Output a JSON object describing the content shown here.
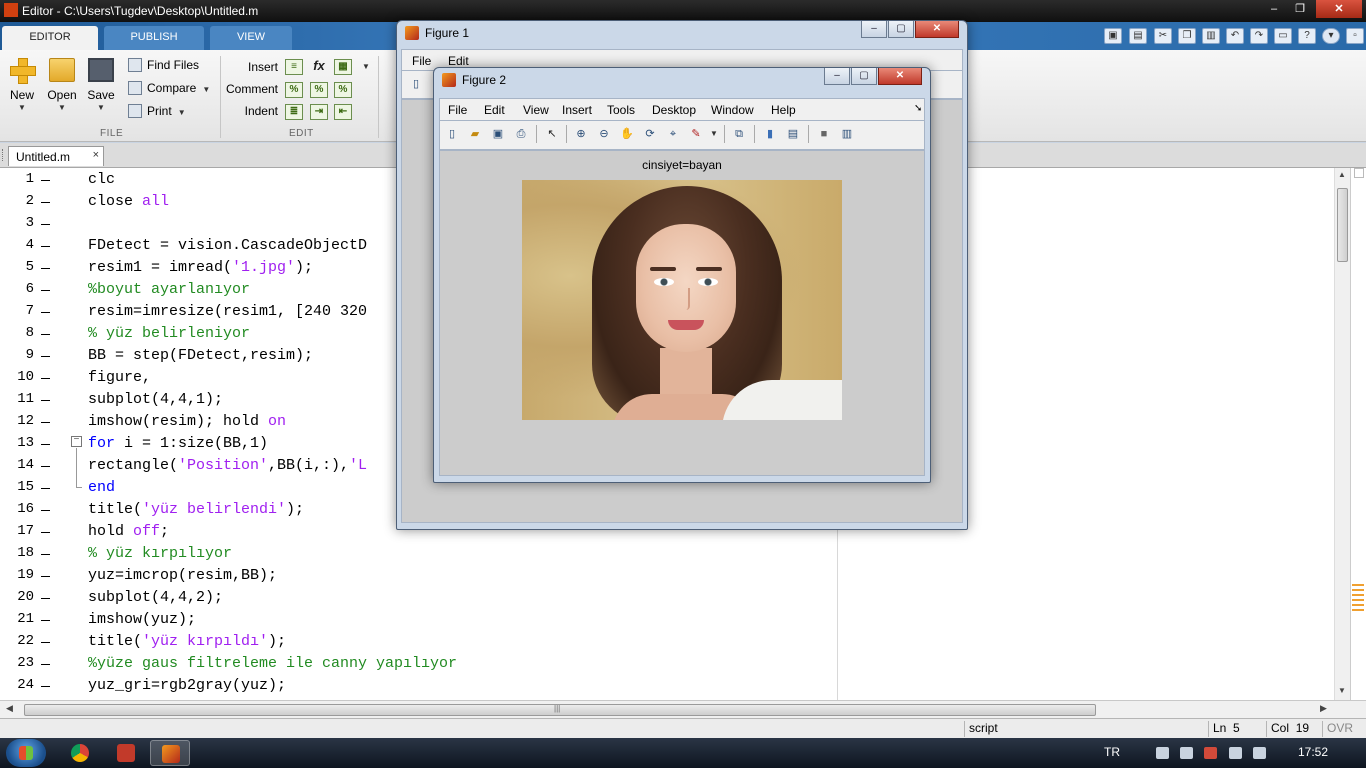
{
  "window": {
    "title": "Editor - C:\\Users\\Tugdev\\Desktop\\Untitled.m",
    "controls": {
      "minimize": "–",
      "maximize": "❐",
      "close": "✕"
    }
  },
  "ribbon": {
    "tabs": [
      "EDITOR",
      "PUBLISH",
      "VIEW"
    ],
    "file_group": {
      "label": "FILE",
      "new": "New",
      "open": "Open",
      "save": "Save",
      "find_files": "Find Files",
      "compare": "Compare",
      "print": "Print"
    },
    "edit_group": {
      "label": "EDIT",
      "insert": "Insert",
      "comment": "Comment",
      "indent": "Indent",
      "fx": "fx"
    }
  },
  "document_tabs": [
    {
      "name": "Untitled.m",
      "close": "×"
    }
  ],
  "editor": {
    "lines": [
      {
        "n": "1",
        "segs": [
          {
            "t": "clc",
            "c": "plain"
          }
        ]
      },
      {
        "n": "2",
        "segs": [
          {
            "t": "close ",
            "c": "plain"
          },
          {
            "t": "all",
            "c": "str"
          }
        ]
      },
      {
        "n": "3",
        "segs": []
      },
      {
        "n": "4",
        "segs": [
          {
            "t": "FDetect = vision.CascadeObjectD",
            "c": "plain"
          }
        ]
      },
      {
        "n": "5",
        "segs": [
          {
            "t": "resim1 = imread(",
            "c": "plain"
          },
          {
            "t": "'1.jpg'",
            "c": "str"
          },
          {
            "t": ");",
            "c": "plain"
          }
        ]
      },
      {
        "n": "6",
        "segs": [
          {
            "t": "%boyut ayarlanıyor",
            "c": "cmt"
          }
        ]
      },
      {
        "n": "7",
        "segs": [
          {
            "t": "resim=imresize(resim1, [240 320",
            "c": "plain"
          }
        ]
      },
      {
        "n": "8",
        "segs": [
          {
            "t": "% yüz belirleniyor",
            "c": "cmt"
          }
        ]
      },
      {
        "n": "9",
        "segs": [
          {
            "t": "BB = step(FDetect,resim);",
            "c": "plain"
          }
        ]
      },
      {
        "n": "10",
        "segs": [
          {
            "t": "figure,",
            "c": "plain"
          }
        ]
      },
      {
        "n": "11",
        "segs": [
          {
            "t": "subplot(4,4,1);",
            "c": "plain"
          }
        ]
      },
      {
        "n": "12",
        "segs": [
          {
            "t": "imshow(resim); hold ",
            "c": "plain"
          },
          {
            "t": "on",
            "c": "str"
          }
        ]
      },
      {
        "n": "13",
        "segs": [
          {
            "t": "for",
            "c": "kw"
          },
          {
            "t": " i = 1:size(BB,1)",
            "c": "plain"
          }
        ]
      },
      {
        "n": "14",
        "segs": [
          {
            "t": "rectangle(",
            "c": "plain"
          },
          {
            "t": "'Position'",
            "c": "str"
          },
          {
            "t": ",BB(i,:),",
            "c": "plain"
          },
          {
            "t": "'L",
            "c": "str"
          }
        ]
      },
      {
        "n": "15",
        "segs": [
          {
            "t": "end",
            "c": "kw"
          }
        ]
      },
      {
        "n": "16",
        "segs": [
          {
            "t": "title(",
            "c": "plain"
          },
          {
            "t": "'yüz belirlendi'",
            "c": "str"
          },
          {
            "t": ");",
            "c": "plain"
          }
        ]
      },
      {
        "n": "17",
        "segs": [
          {
            "t": "hold ",
            "c": "plain"
          },
          {
            "t": "off",
            "c": "str"
          },
          {
            "t": ";",
            "c": "plain"
          }
        ]
      },
      {
        "n": "18",
        "segs": [
          {
            "t": "% yüz kırpılıyor",
            "c": "cmt"
          }
        ]
      },
      {
        "n": "19",
        "segs": [
          {
            "t": "yuz=imcrop(resim,BB);",
            "c": "plain"
          }
        ]
      },
      {
        "n": "20",
        "segs": [
          {
            "t": "subplot(4,4,2);",
            "c": "plain"
          }
        ]
      },
      {
        "n": "21",
        "segs": [
          {
            "t": "imshow(yuz);",
            "c": "plain"
          }
        ]
      },
      {
        "n": "22",
        "segs": [
          {
            "t": "title(",
            "c": "plain"
          },
          {
            "t": "'yüz kırpıldı'",
            "c": "str"
          },
          {
            "t": ");",
            "c": "plain"
          }
        ]
      },
      {
        "n": "23",
        "segs": [
          {
            "t": "%yüze gaus filtreleme ile canny yapılıyor",
            "c": "cmt"
          }
        ]
      },
      {
        "n": "24",
        "segs": [
          {
            "t": "yuz_gri=rgb2gray(yuz);",
            "c": "plain"
          }
        ]
      }
    ]
  },
  "statusbar": {
    "mode": "script",
    "ln_label": "Ln",
    "ln": "5",
    "col_label": "Col",
    "col": "19",
    "ovr": "OVR"
  },
  "figure1": {
    "title": "Figure 1",
    "menu": [
      "File",
      "Edit",
      "View",
      "Insert",
      "Tools",
      "Desktop",
      "Window",
      "Help"
    ],
    "controls": {
      "minimize": "–",
      "maximize": "▢",
      "close": "✕"
    }
  },
  "figure2": {
    "title": "Figure 2",
    "menu": [
      "File",
      "Edit",
      "View",
      "Insert",
      "Tools",
      "Desktop",
      "Window",
      "Help"
    ],
    "controls": {
      "minimize": "–",
      "maximize": "▢",
      "close": "✕"
    },
    "axes_title": "cinsiyet=bayan",
    "dock_arrow": "➘"
  },
  "taskbar": {
    "language": "TR",
    "clock": "17:52"
  },
  "colors": {
    "keyword": "#0000ff",
    "string": "#a020f0",
    "comment": "#228b22",
    "ribbon_blue": "#2a6aa9"
  }
}
